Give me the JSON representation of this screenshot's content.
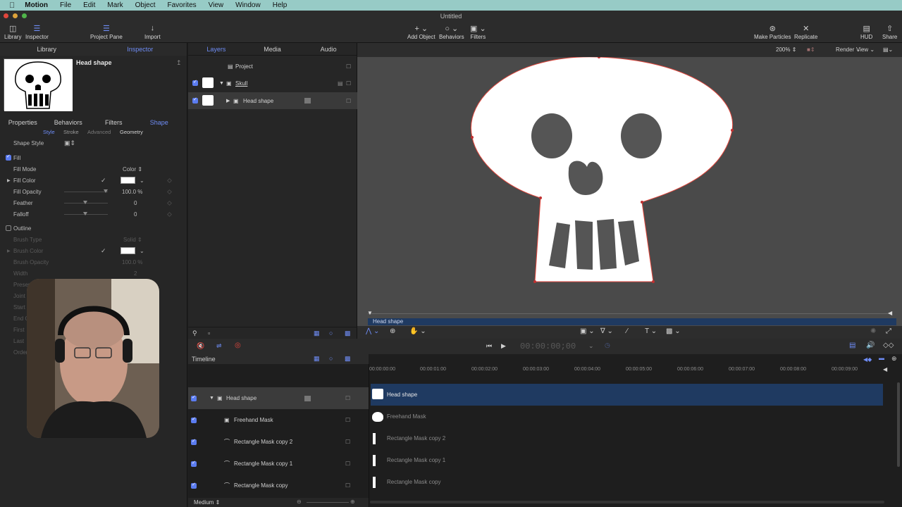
{
  "menubar": {
    "app": "Motion",
    "items": [
      "File",
      "Edit",
      "Mark",
      "Object",
      "Favorites",
      "View",
      "Window",
      "Help"
    ]
  },
  "window": {
    "title": "Untitled"
  },
  "toolbar": {
    "library": "Library",
    "inspector": "Inspector",
    "project_pane": "Project Pane",
    "import": "Import",
    "add_object": "Add Object",
    "behaviors": "Behaviors",
    "filters": "Filters",
    "make_particles": "Make Particles",
    "replicate": "Replicate",
    "hud": "HUD",
    "share": "Share"
  },
  "left_panel": {
    "tabs": [
      "Library",
      "Inspector"
    ],
    "preview_title": "Head shape",
    "inspector_tabs": [
      "Properties",
      "Behaviors",
      "Filters",
      "Shape"
    ],
    "sub_tabs": [
      "Style",
      "Stroke",
      "Advanced",
      "Geometry"
    ],
    "shape_style": "Shape Style",
    "fill_header": "Fill",
    "fill_mode": {
      "label": "Fill Mode",
      "value": "Color"
    },
    "fill_color": {
      "label": "Fill Color"
    },
    "fill_opacity": {
      "label": "Fill Opacity",
      "value": "100.0",
      "unit": "%"
    },
    "feather": {
      "label": "Feather",
      "value": "0"
    },
    "falloff": {
      "label": "Falloff",
      "value": "0"
    },
    "outline_header": "Outline",
    "brush_type": {
      "label": "Brush Type",
      "value": "Solid"
    },
    "brush_color": {
      "label": "Brush Color"
    },
    "brush_opacity": {
      "label": "Brush Opacity",
      "value": "100.0 %"
    },
    "width": {
      "label": "Width",
      "value": "2"
    },
    "hidden_labels": [
      "Preser",
      "Joint",
      "Start",
      "End O",
      "First",
      "Last",
      "Order"
    ]
  },
  "layers_panel": {
    "tabs": [
      "Layers",
      "Media",
      "Audio"
    ],
    "rows": [
      {
        "name": "Project"
      },
      {
        "name": "Skull"
      },
      {
        "name": "Head shape"
      }
    ]
  },
  "canvas": {
    "zoom": "200%",
    "render": "Render",
    "view": "View",
    "selected_label": "Head shape"
  },
  "transport": {
    "timecode": "00:00:00;00"
  },
  "timeline": {
    "title": "Timeline",
    "ruler": [
      "00:00:00:00",
      "00:00:01:00",
      "00:00:02:00",
      "00:00:03:00",
      "00:00:04:00",
      "00:00:05:00",
      "00:00:06:00",
      "00:00:07:00",
      "00:00:08:00",
      "00:00:09:00"
    ],
    "tracks": [
      "Head shape",
      "Freehand Mask",
      "Rectangle Mask copy 2",
      "Rectangle Mask copy 1",
      "Rectangle Mask copy"
    ],
    "size": "Medium"
  },
  "colors": {
    "accent": "#5b7cf0",
    "menubar": "#97cbc6",
    "selection": "#1f3a61",
    "shape_outline": "#e0463c"
  }
}
